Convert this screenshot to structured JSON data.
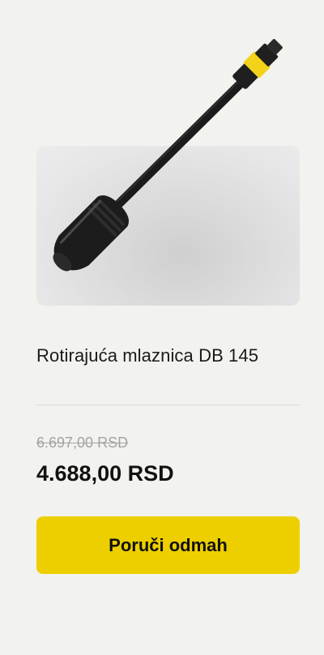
{
  "product": {
    "title": "Rotirajuća mlaznica DB 145",
    "image_description": "product-photo",
    "old_price": "6.697,00 RSD",
    "price": "4.688,00 RSD",
    "order_button_label": "Poruči odmah"
  },
  "colors": {
    "background": "#f2f2ee",
    "button": "#edcf00",
    "accent_yellow": "#f3d21a",
    "text": "#111111",
    "old_price": "#a3a3a3"
  }
}
